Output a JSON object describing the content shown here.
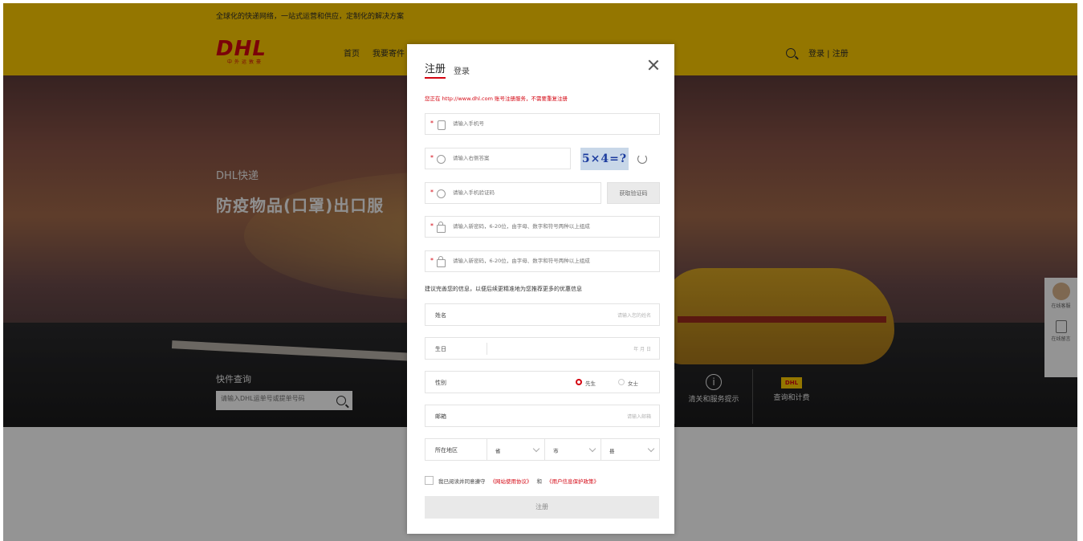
{
  "header": {
    "tagline": "全球化的快递网络，一站式运营和供应，定制化的解决方案",
    "logo_text": "DHL",
    "logo_sub": "中外运敦豪",
    "nav": [
      "首页",
      "我要寄件"
    ],
    "login_link": "登录 | 注册"
  },
  "hero": {
    "kicker": "DHL快递",
    "title": "防疫物品(口罩)出口服",
    "track_label": "快件查询",
    "track_placeholder": "请输入DHL运单号或提单号码",
    "tiles": [
      {
        "icon": "info-icon",
        "label": "清关和服务提示"
      },
      {
        "icon": "dhl-box-icon",
        "badge": "DHL",
        "label": "查询和计费"
      }
    ]
  },
  "side_widget": {
    "chat_label": "在线客服",
    "doc_label": "在线留言"
  },
  "modal": {
    "tab_register": "注册",
    "tab_login": "登录",
    "notice": "您正在 http://www.dhl.com 账号注册服务，不需要重复注册",
    "phone_placeholder": "请输入手机号",
    "captcha_placeholder": "请输入右侧答案",
    "captcha_text": "5×4=?",
    "sms_placeholder": "请输入手机验证码",
    "sms_button": "获取验证码",
    "password_placeholder": "请输入新密码，6-20位，由字母、数字和符号两种以上组成",
    "confirm_placeholder": "请输入新密码，6-20位，由字母、数字和符号两种以上组成",
    "section_tip": "建议完善您的信息，以便后续更精准地为您推荐更多的优惠信息",
    "name_label": "姓名",
    "name_placeholder": "请输入您的姓名",
    "birthday_label": "生日",
    "birthday_placeholder": "年 月 日",
    "gender_label": "性别",
    "gender_options": [
      "先生",
      "女士"
    ],
    "email_label": "邮箱",
    "email_placeholder": "请输入邮箱",
    "region_label": "所在地区",
    "region_selects": [
      "省",
      "市",
      "县"
    ],
    "agree_text": "我已阅读并同意遵守",
    "agree_link1": "《网站使用协议》",
    "agree_and": "和",
    "agree_link2": "《用户信息保护政策》",
    "submit_label": "注册"
  },
  "colors": {
    "brand_yellow": "#ffcc00",
    "brand_red": "#d40511"
  }
}
